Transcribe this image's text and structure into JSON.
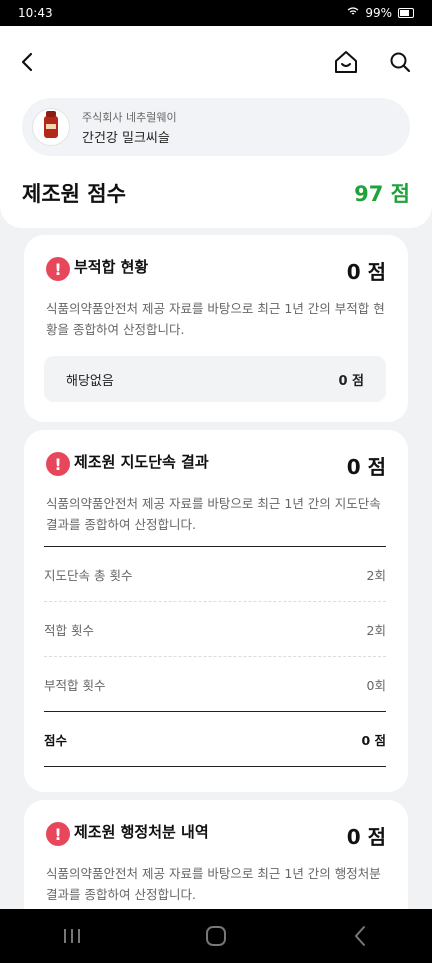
{
  "status_bar": {
    "time": "10:43",
    "battery": "99%"
  },
  "product": {
    "maker": "주식회사 네추럴웨이",
    "name": "간건강 밀크씨슬"
  },
  "summary": {
    "title": "제조원 점수",
    "score": "97 점"
  },
  "cards": [
    {
      "title": "부적합 현황",
      "score": "0 점",
      "desc": "식품의약품안전처 제공 자료를 바탕으로 최근 1년 간의 부적합 현황을 종합하여 산정합니다.",
      "box": {
        "label": "해당없음",
        "value": "0 점"
      }
    },
    {
      "title": "제조원 지도단속 결과",
      "score": "0 점",
      "desc": "식품의약품안전처 제공 자료를 바탕으로 최근 1년 간의 지도단속 결과를 종합하여 산정합니다.",
      "rows": [
        {
          "label": "지도단속 총 횟수",
          "value": "2회"
        },
        {
          "label": "적합 횟수",
          "value": "2회"
        },
        {
          "label": "부적합 횟수",
          "value": "0회"
        }
      ],
      "total": {
        "label": "점수",
        "value": "0 점"
      }
    },
    {
      "title": "제조원 행정처분 내역",
      "score": "0 점",
      "desc": "식품의약품안전처 제공 자료를 바탕으로 최근 1년 간의 행정처분 결과를 종합하여 산정합니다."
    }
  ],
  "icons": {
    "back": "chevron-left-icon",
    "home": "home-icon",
    "search": "search-icon",
    "alert": "exclamation-icon"
  },
  "colors": {
    "score_green": "#1ea33a",
    "alert_red": "#e8465b"
  }
}
